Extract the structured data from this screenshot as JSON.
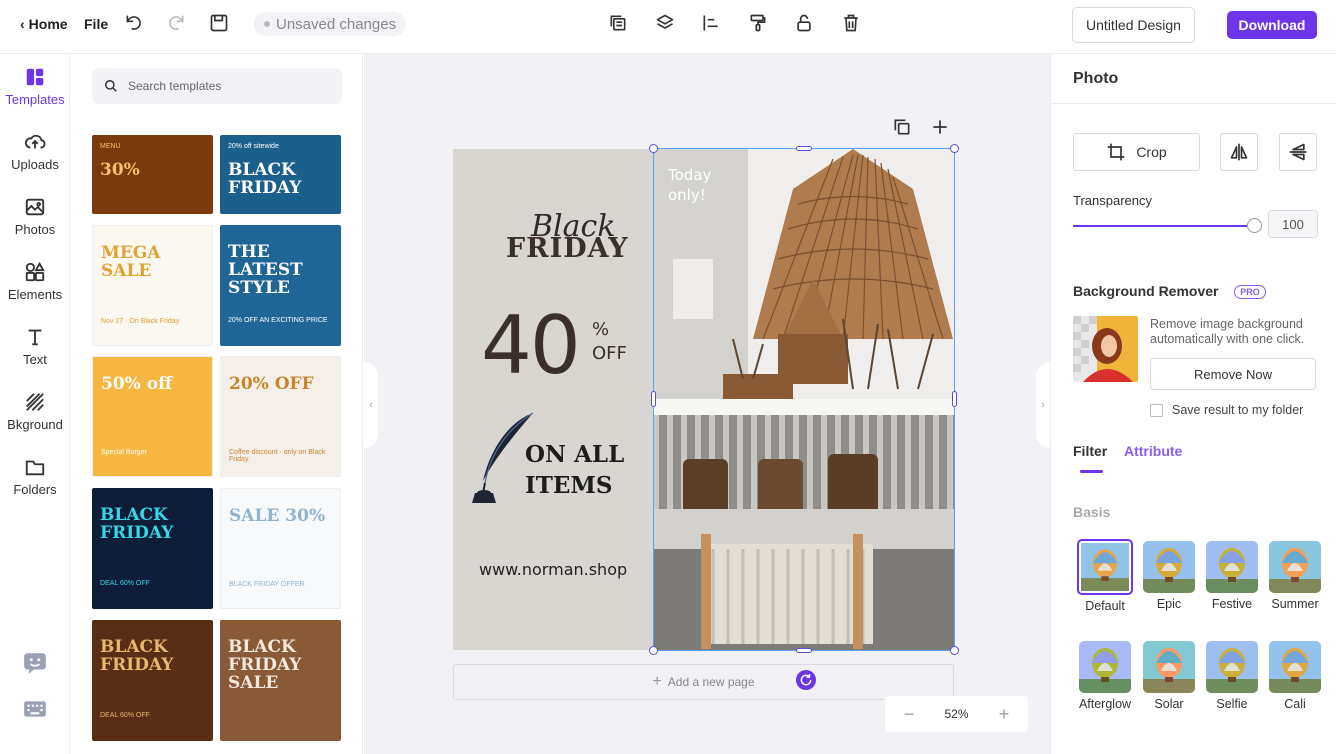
{
  "topbar": {
    "home_label": "Home",
    "file_label": "File",
    "unsaved_label": "Unsaved changes",
    "design_name": "Untitled Design",
    "download_label": "Download",
    "tools": [
      "copy-icon",
      "layers-icon",
      "align-left-icon",
      "format-paint-icon",
      "unlock-icon",
      "delete-icon"
    ]
  },
  "rail": {
    "items": [
      {
        "label": "Templates",
        "icon": "templates-icon",
        "active": true
      },
      {
        "label": "Uploads",
        "icon": "upload-cloud-icon",
        "active": false
      },
      {
        "label": "Photos",
        "icon": "image-icon",
        "active": false
      },
      {
        "label": "Elements",
        "icon": "shapes-icon",
        "active": false
      },
      {
        "label": "Text",
        "icon": "text-t-icon",
        "active": false
      },
      {
        "label": "Bkground",
        "icon": "background-stripes-icon",
        "active": false
      },
      {
        "label": "Folders",
        "icon": "folder-icon",
        "active": false
      }
    ]
  },
  "templates": {
    "search_placeholder": "Search templates",
    "thumbs": [
      {
        "title": "30%",
        "sub": "MENU",
        "bg": "#7a3a0c",
        "fg": "#f5c46a"
      },
      {
        "title": "BLACK FRIDAY",
        "sub": "20% off sitewide",
        "bg": "#1b5f8c",
        "fg": "#ffffff"
      },
      {
        "title": "MEGA SALE",
        "sub": "Nov 27 · On Black Friday",
        "bg": "#fbf7f1",
        "fg": "#e0a232"
      },
      {
        "title": "THE LATEST STYLE",
        "sub": "20% OFF AN EXCITING PRICE",
        "bg": "#1f6696",
        "fg": "#ffffff"
      },
      {
        "title": "50% off",
        "sub": "Special Burger",
        "bg": "#f5b73f",
        "fg": "#ffffff"
      },
      {
        "title": "20% OFF",
        "sub": "Coffee discount · only on Black Friday",
        "bg": "#f4efe9",
        "fg": "#c8862c"
      },
      {
        "title": "BLACK FRIDAY",
        "sub": "DEAL 60% OFF",
        "bg": "#0e1e3a",
        "fg": "#36d6e7"
      },
      {
        "title": "SALE 30%",
        "sub": "BLACK FRIDAY OFFER",
        "bg": "#f7f9fb",
        "fg": "#8fb4cf"
      },
      {
        "title": "BLACK FRIDAY",
        "sub": "DEAL 60% OFF",
        "bg": "#5a2e14",
        "fg": "#e8b66e"
      },
      {
        "title": "BLACK FRIDAY SALE",
        "sub": "",
        "bg": "#8a5a37",
        "fg": "#f3e8dc"
      }
    ]
  },
  "canvas": {
    "script_title": "Black",
    "title": "FRIDAY",
    "big_number": "40",
    "percent": "%",
    "off": "OFF",
    "line1": "ON ALL",
    "line2": "ITEMS",
    "url": "www.norman.shop",
    "badge_line1": "Today",
    "badge_line2": "only!",
    "add_page_label": "Add a new page",
    "zoom": "52%"
  },
  "right_panel": {
    "title": "Photo",
    "crop_label": "Crop",
    "transparency_label": "Transparency",
    "transparency_value": "100",
    "transparency_fraction": 1.0,
    "bg_remover_title": "Background Remover",
    "pro_label": "PRO",
    "bg_remover_desc": "Remove image background automatically with one click.",
    "remove_label": "Remove Now",
    "save_label": "Save result to my folder",
    "tab_filter": "Filter",
    "tab_attribute": "Attribute",
    "basis_label": "Basis",
    "filters": [
      "Default",
      "Epic",
      "Festive",
      "Summer",
      "Afterglow",
      "Solar",
      "Selfie",
      "Cali"
    ],
    "selected_filter": "Default"
  },
  "colors": {
    "accent": "#6e34e8",
    "selection": "#5aa0ff"
  }
}
